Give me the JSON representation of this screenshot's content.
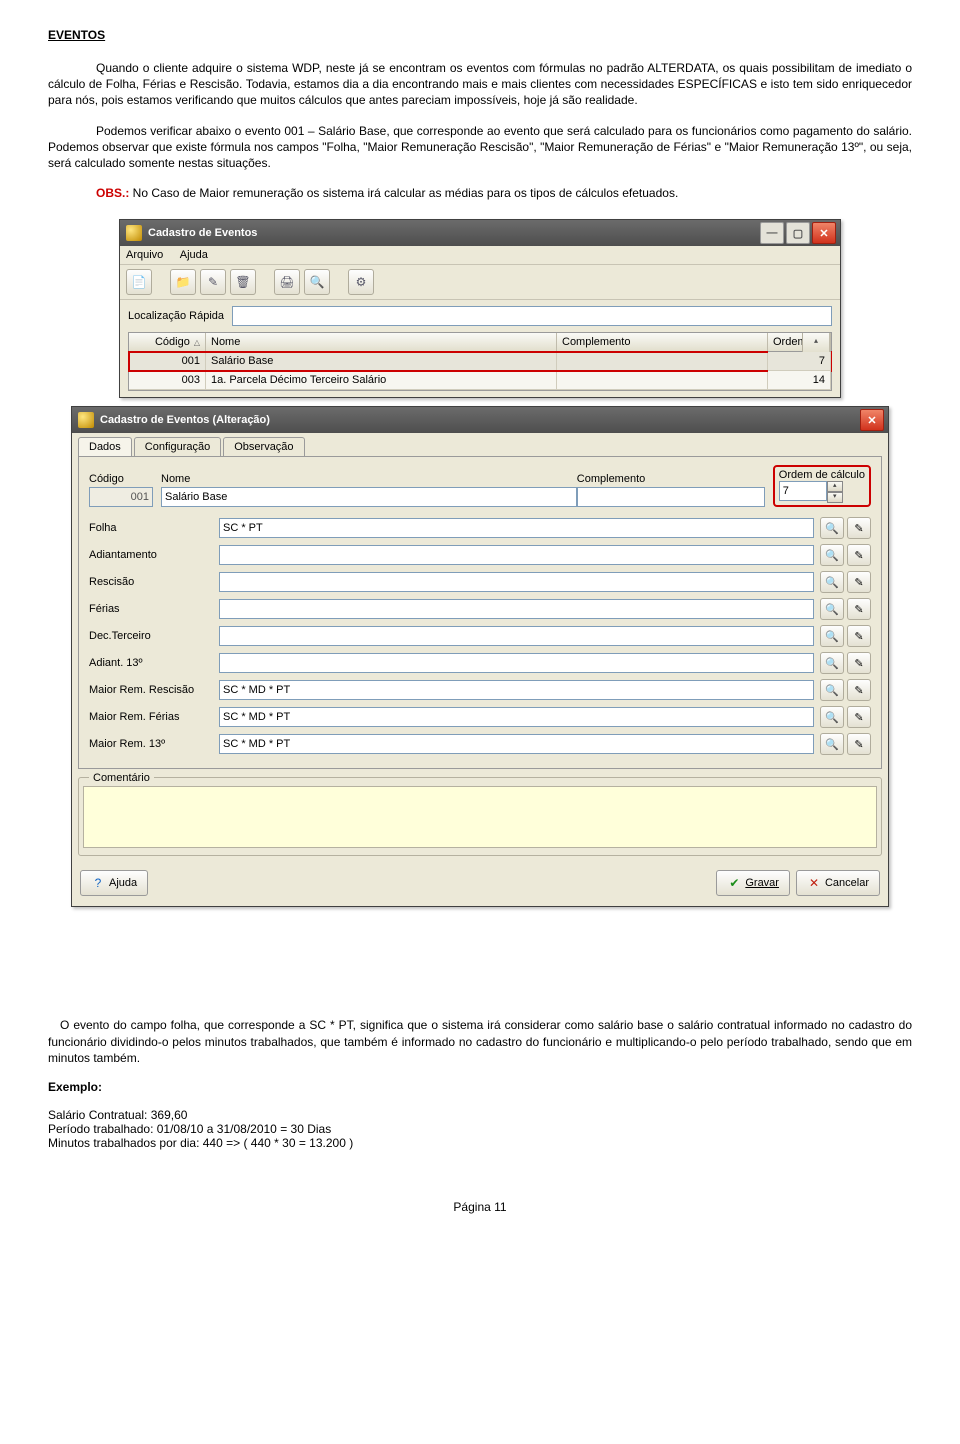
{
  "heading": "EVENTOS",
  "paragraphs": {
    "p1": "Quando o cliente adquire o sistema WDP, neste já se encontram os eventos com fórmulas no padrão ALTERDATA, os quais possibilitam de imediato o cálculo de Folha, Férias e Rescisão. Todavia, estamos dia a dia encontrando mais e mais clientes com necessidades ESPECÍFICAS e isto tem sido enriquecedor para nós, pois estamos verificando que muitos cálculos que antes pareciam impossíveis, hoje já são realidade.",
    "p2": "Podemos verificar abaixo o evento 001 – Salário Base, que corresponde ao evento que será calculado para os funcionários como pagamento do salário. Podemos observar que existe fórmula nos campos \"Folha, \"Maior Remuneração Rescisão\", \"Maior Remuneração de Férias\" e \"Maior Remuneração 13º\", ou seja, será calculado somente nestas situações.",
    "obs_label": "OBS.:",
    "obs_text": " No Caso de Maior remuneração os sistema irá calcular as médias para os tipos de cálculos efetuados.",
    "p3": "O evento do campo folha, que corresponde a SC * PT, significa que o sistema irá considerar como salário base o salário contratual informado no cadastro do funcionário dividindo-o pelos minutos trabalhados, que também é informado no cadastro do funcionário e multiplicando-o pelo período trabalhado, sendo que em minutos também.",
    "exemplo_label": "Exemplo:",
    "ex1": "Salário Contratual: 369,60",
    "ex2": "Período trabalhado: 01/08/10 a 31/08/2010 = 30 Dias",
    "ex3": "Minutos trabalhados por dia: 440 => ( 440 * 30 = 13.200 )"
  },
  "win1": {
    "title": "Cadastro de Eventos",
    "menu": {
      "arquivo": "Arquivo",
      "ajuda": "Ajuda"
    },
    "quick_label": "Localização Rápida",
    "cols": {
      "codigo": "Código",
      "nome": "Nome",
      "complemento": "Complemento",
      "ordem": "Ordem"
    },
    "rows": [
      {
        "codigo": "001",
        "nome": "Salário Base",
        "complemento": "",
        "ordem": "7"
      },
      {
        "codigo": "003",
        "nome": "1a. Parcela Décimo Terceiro Salário",
        "complemento": "",
        "ordem": "14"
      }
    ]
  },
  "win2": {
    "title": "Cadastro de Eventos (Alteração)",
    "tabs": {
      "dados": "Dados",
      "config": "Configuração",
      "obs": "Observação"
    },
    "labels": {
      "codigo": "Código",
      "nome": "Nome",
      "complemento": "Complemento",
      "ordem": "Ordem de cálculo"
    },
    "values": {
      "codigo": "001",
      "nome": "Salário Base",
      "complemento": "",
      "ordem": "7"
    },
    "rows": [
      {
        "label": "Folha",
        "value": "SC * PT"
      },
      {
        "label": "Adiantamento",
        "value": ""
      },
      {
        "label": "Rescisão",
        "value": ""
      },
      {
        "label": "Férias",
        "value": ""
      },
      {
        "label": "Dec.Terceiro",
        "value": ""
      },
      {
        "label": "Adiant. 13º",
        "value": ""
      },
      {
        "label": "Maior Rem. Rescisão",
        "value": "SC * MD * PT"
      },
      {
        "label": "Maior Rem. Férias",
        "value": "SC * MD * PT"
      },
      {
        "label": "Maior Rem. 13º",
        "value": "SC * MD * PT"
      }
    ],
    "comment_label": "Comentário",
    "buttons": {
      "ajuda": "Ajuda",
      "gravar": "Gravar",
      "cancelar": "Cancelar"
    }
  },
  "footer": "Página 11"
}
